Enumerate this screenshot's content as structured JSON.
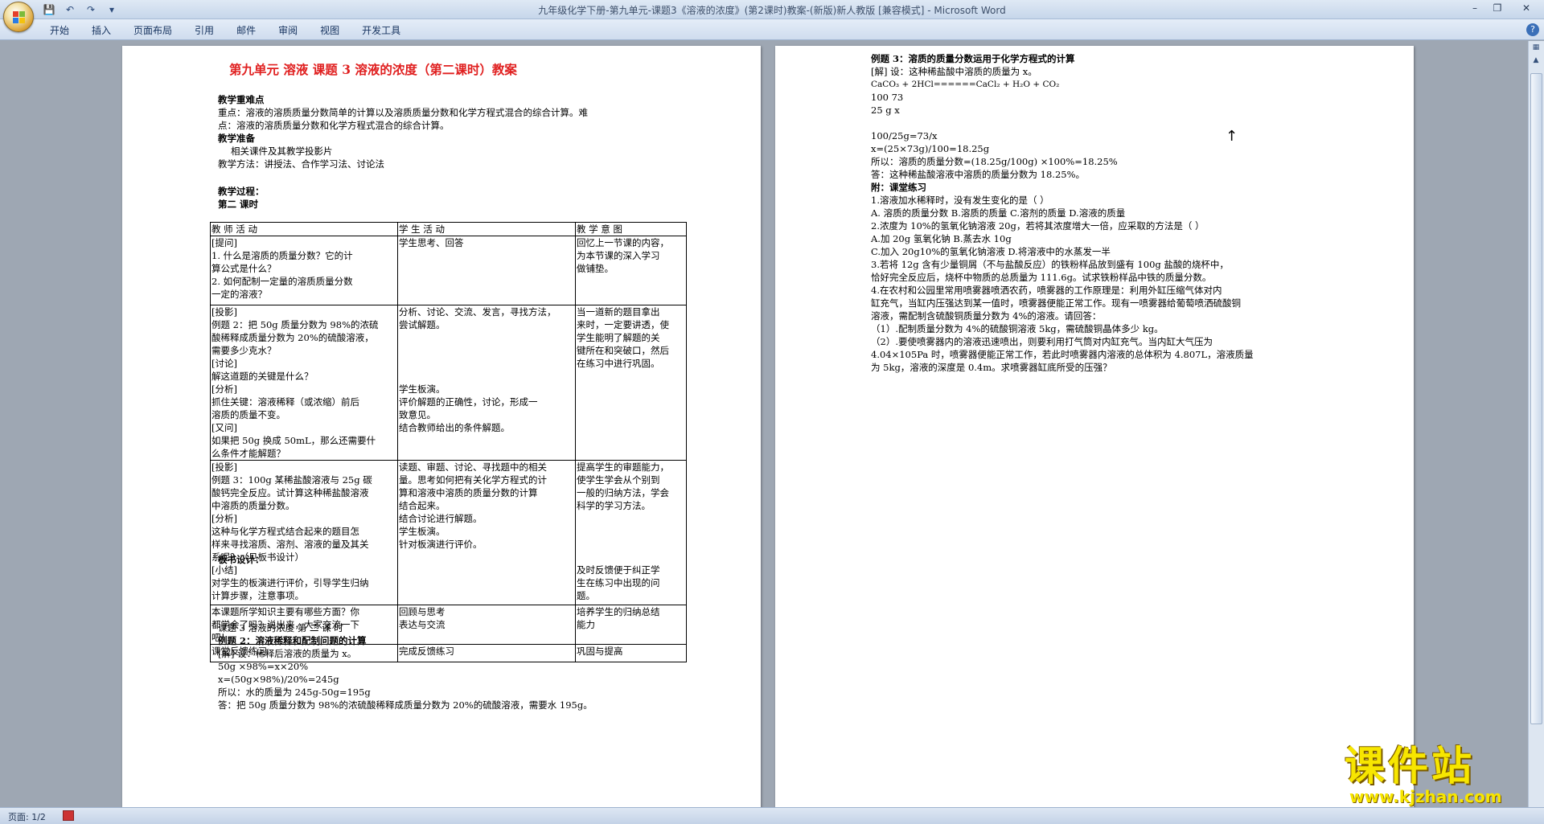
{
  "window": {
    "title": "九年级化学下册-第九单元-课题3《溶液的浓度》(第2课时)教案-(新版)新人教版 [兼容模式] - Microsoft Word"
  },
  "menu": {
    "tabs": [
      "开始",
      "插入",
      "页面布局",
      "引用",
      "邮件",
      "审阅",
      "视图",
      "开发工具"
    ]
  },
  "status": {
    "page": "页面: 1/2"
  },
  "watermark": {
    "text": "课件站",
    "url": "www.kjzhan.com"
  },
  "page1": {
    "title": "第九单元  溶液  课题 3  溶液的浓度（第二课时）教案",
    "lines": [
      "教学重难点",
      "重点：溶液的溶质质量分数简单的计算以及溶质质量分数和化学方程式混合的综合计算。难",
      "点：溶液的溶质质量分数和化学方程式混合的综合计算。",
      "教学准备",
      "相关课件及其教学投影片",
      "教学方法：讲授法、合作学习法、讨论法",
      "",
      "教学过程：",
      "第二  课时"
    ],
    "table": {
      "headers": [
        "教    师    活    动",
        "学    生    活    动",
        "教  学  意  图"
      ],
      "rows": [
        [
          "[提问]\n1. 什么是溶质的质量分数？它的计\n   算公式是什么？\n2. 如何配制一定量的溶质质量分数\n   一定的溶液？",
          "学生思考、回答",
          "回忆上一节课的内容，\n为本节课的深入学习\n做铺垫。"
        ],
        [
          "[投影]\n例题 2：把 50g 质量分数为 98%的浓硫\n酸稀释成质量分数为 20%的硫酸溶液，\n需要多少克水？\n[讨论]\n解这道题的关键是什么？\n[分析]\n抓住关键：溶液稀释（或浓缩）前后\n溶质的质量不变。\n[又问]\n如果把 50g 换成 50mL，那么还需要什\n么条件才能解题？",
          "分析、讨论、交流、发言，寻找方法，\n尝试解题。\n\n\n\n\n学生板演。\n评价解题的正确性，讨论，形成一\n致意见。\n结合教师给出的条件解题。",
          "当一道新的题目拿出\n来时，一定要讲透，使\n学生能明了解题的关\n键所在和突破口，然后\n在练习中进行巩固。"
        ],
        [
          "[投影]\n例题 3：100g 某稀盐酸溶液与 25g 碳\n酸钙完全反应。试计算这种稀盐酸溶液\n中溶质的质量分数。\n[分析]\n这种与化学方程式结合起来的题目怎\n样来寻找溶质、溶剂、溶液的量及其关\n系呢？（见板书设计）\n[小结]\n对学生的板演进行评价，引导学生归纳\n计算步骤，注意事项。",
          "读题、审题、讨论、寻找题中的相关\n量。思考如何把有关化学方程式的计\n算和溶液中溶质的质量分数的计算\n结合起来。\n结合讨论进行解题。\n学生板演。\n针对板演进行评价。",
          "提高学生的审题能力，\n使学生学会从个别到\n一般的归纳方法，学会\n科学的学习方法。\n\n\n\n\n及时反馈便于纠正学\n生在练习中出现的问\n题。"
        ],
        [
          "本课题所学知识主要有哪些方面？你\n都学会了吗？说出来，大家交流一下\n吧！",
          "回顾与思考\n表达与交流",
          "培养学生的归纳总结\n能力"
        ],
        [
          "课堂反馈练习",
          "完成反馈练习",
          "巩固与提高"
        ]
      ]
    },
    "board_label": "板书设计：",
    "board_lines": [
      "课题 3        溶液的浓度  第         二         课          时",
      "例题 2：溶液稀释和配制问题的计算",
      "[解]  设：稀释后溶液的质量为 x。",
      "   50g  ×98%=x×20%",
      "x=(50g×98%)/20%=245g",
      "所以：水的质量为 245g-50g=195g",
      "答：把 50g 质量分数为 98%的浓硫酸稀释成质量分数为 20%的硫酸溶液，需要水 195g。"
    ]
  },
  "page2": {
    "lines": [
      "例题 3：溶质的质量分数运用于化学方程式的计算",
      "[解]   设：这种稀盐酸中溶质的质量为 x。",
      "CaCO₃        +       2HCl======CaCl₂    +       H₂O     +   CO₂",
      "100                 73",
      "25 g                  x",
      "",
      "100/25g=73/x",
      "x=(25×73g)/100=18.25g",
      "所以：溶质的质量分数=(18.25g/100g) ×100%=18.25%",
      "答：这种稀盐酸溶液中溶质的质量分数为 18.25%。",
      "附：课堂练习",
      "1.溶液加水稀释时，没有发生变化的是（        ）",
      "A. 溶质的质量分数  B.溶质的质量  C.溶剂的质量  D.溶液的质量",
      "2.浓度为 10%的氢氧化钠溶液 20g，若将其浓度增大一倍，应采取的方法是（      ）",
      "        A.加 20g 氢氧化钠    B.蒸去水 10g",
      "     C.加入 20g10%的氢氧化钠溶液  D.将溶液中的水蒸发一半",
      "    3.若将 12g 含有少量铜屑（不与盐酸反应）的铁粉样品放到盛有 100g 盐酸的烧杯中，",
      "恰好完全反应后，烧杯中物质的总质量为 111.6g。试求铁粉样品中铁的质量分数。",
      "    4.在农村和公园里常用喷雾器喷洒农药，喷雾器的工作原理是：利用外缸压缩气体对内",
      "缸充气，当缸内压强达到某一值时，喷雾器便能正常工作。现有一喷雾器给葡萄喷洒硫酸铜",
      "溶液，需配制含硫酸铜质量分数为 4%的溶液。请回答：",
      "    （1）.配制质量分数为 4%的硫酸铜溶液 5kg，需硫酸铜晶体多少 kg。",
      "    （2）.要使喷雾器内的溶液迅速喷出，则要利用打气筒对内缸充气。当内缸大气压为",
      "4.04×105Pa 时，喷雾器便能正常工作，若此时喷雾器内溶液的总体积为 4.807L，溶液质量",
      "为 5kg，溶液的深度是 0.4m。求喷雾器缸底所受的压强？"
    ]
  }
}
